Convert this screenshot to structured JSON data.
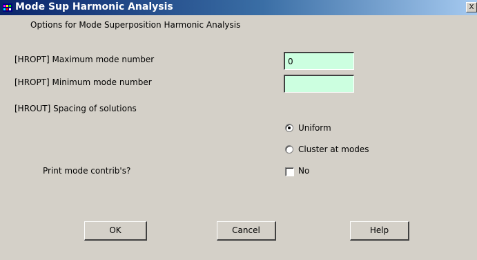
{
  "window": {
    "title": "Mode Sup Harmonic Analysis",
    "close_glyph": "X"
  },
  "dialog": {
    "heading": "Options for Mode Superposition Harmonic Analysis",
    "fields": [
      {
        "label": "[HROPT]  Maximum mode number",
        "value": "0"
      },
      {
        "label": "[HROPT]  Minimum mode number",
        "value": ""
      }
    ],
    "spacing_label": "[HROUT]  Spacing of solutions",
    "spacing_options": [
      {
        "label": "Uniform",
        "selected": true
      },
      {
        "label": "Cluster at modes",
        "selected": false
      }
    ],
    "print_label": "Print mode contrib's?",
    "print_checkbox": {
      "label": "No",
      "checked": false
    }
  },
  "buttons": {
    "ok": "OK",
    "cancel": "Cancel",
    "help": "Help"
  },
  "colors": {
    "field_bg": "#ccffe0",
    "dialog_bg": "#d4d0c8",
    "title_bar_start": "#0a246a",
    "title_bar_end": "#a6caf0"
  }
}
